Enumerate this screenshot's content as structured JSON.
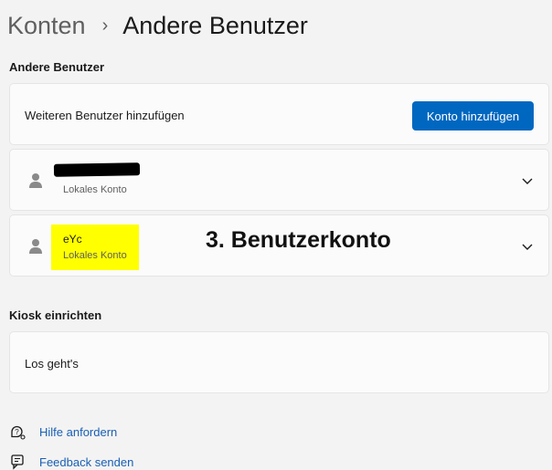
{
  "breadcrumb": {
    "parent": "Konten",
    "separator": "›",
    "current": "Andere Benutzer"
  },
  "other_users_section": {
    "title": "Andere Benutzer",
    "add_row": {
      "label": "Weiteren Benutzer hinzufügen",
      "button": "Konto hinzufügen"
    },
    "users": [
      {
        "name": "",
        "account_type": "Lokales Konto",
        "redacted": true
      },
      {
        "name": "eYc",
        "account_type": "Lokales Konto",
        "highlighted": true,
        "annotation": "3. Benutzerkonto"
      }
    ]
  },
  "kiosk_section": {
    "title": "Kiosk einrichten",
    "row_label": "Los geht's"
  },
  "links": [
    {
      "label": "Hilfe anfordern",
      "icon": "help-icon"
    },
    {
      "label": "Feedback senden",
      "icon": "feedback-icon"
    }
  ],
  "colors": {
    "accent": "#0067c0",
    "link": "#1a5fb4",
    "highlight": "#ffff00"
  }
}
